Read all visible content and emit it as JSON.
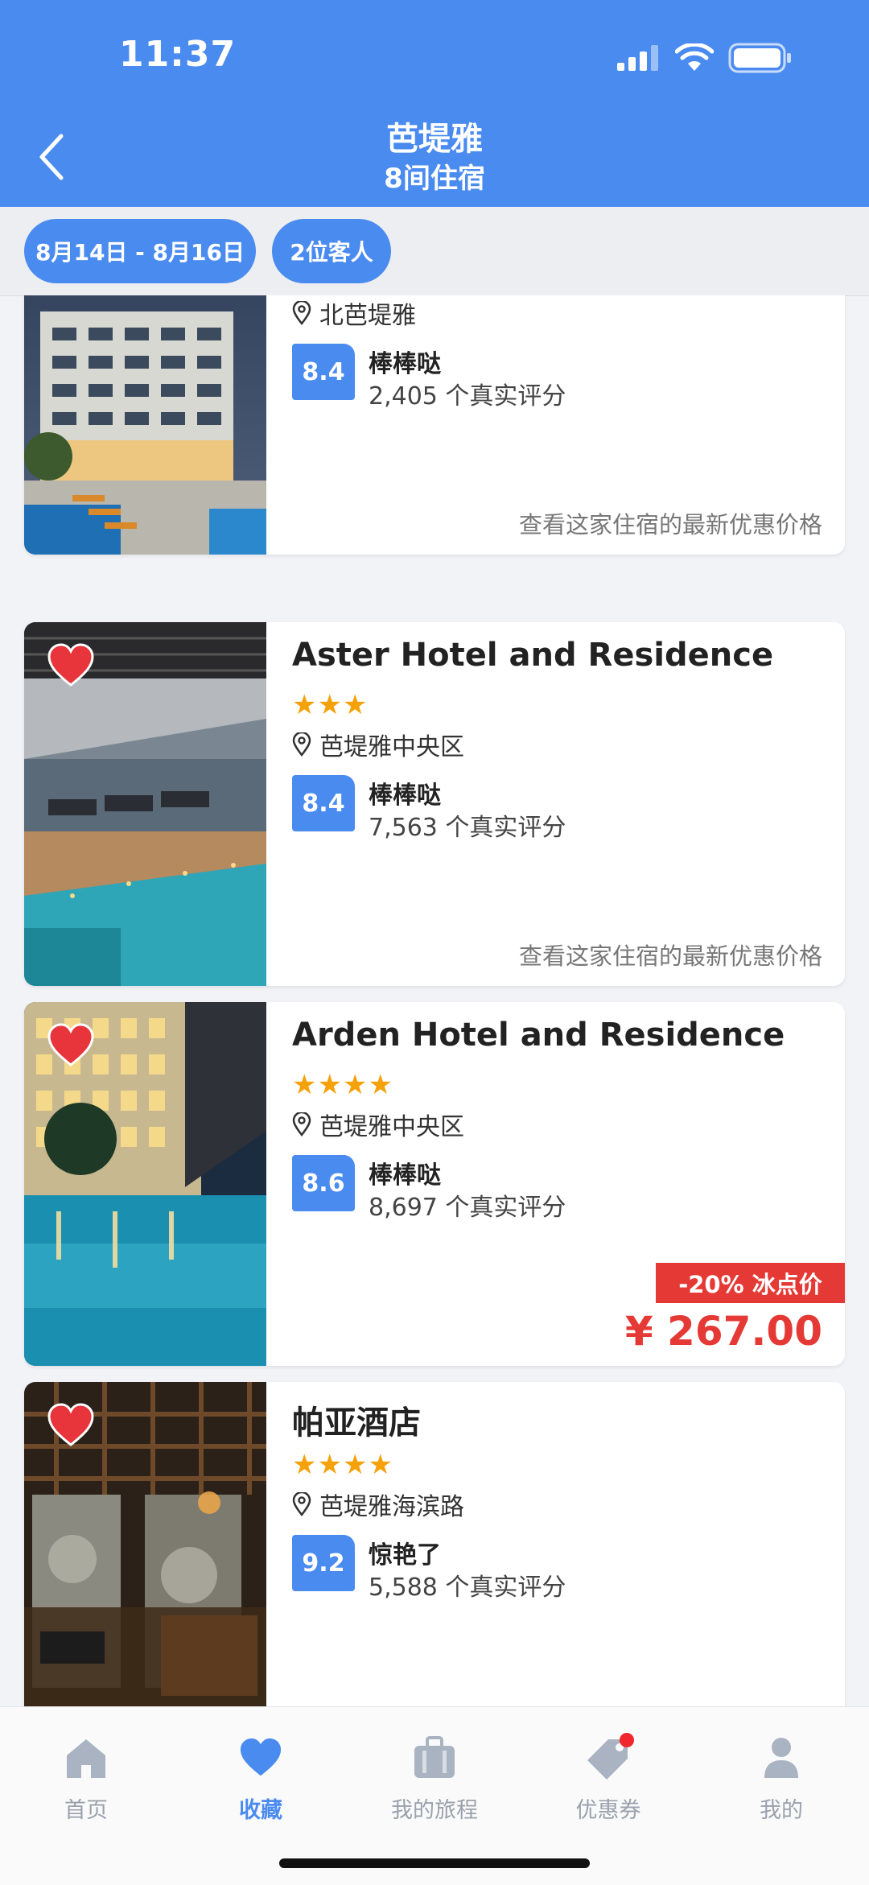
{
  "status_bar": {
    "time": "11:37"
  },
  "header": {
    "title": "芭堤雅",
    "subtitle": "8间住宿"
  },
  "filters": {
    "dates": "8月14日 - 8月16日",
    "guests": "2位客人"
  },
  "hotels": [
    {
      "name": "",
      "stars": "★★★★",
      "location": "北芭堤雅",
      "score": "8.4",
      "score_text": "棒棒哒",
      "reviews": "2,405 个真实评分",
      "price_hint": "查看这家住宿的最新优惠价格"
    },
    {
      "name": "Aster Hotel and Residence",
      "stars": "★★★",
      "location": "芭堤雅中央区",
      "score": "8.4",
      "score_text": "棒棒哒",
      "reviews": "7,563 个真实评分",
      "price_hint": "查看这家住宿的最新优惠价格"
    },
    {
      "name": "Arden Hotel and Residence",
      "stars": "★★★★",
      "location": "芭堤雅中央区",
      "score": "8.6",
      "score_text": "棒棒哒",
      "reviews": "8,697 个真实评分",
      "deal_tag": "-20% 冰点价",
      "price": "¥ 267.00"
    },
    {
      "name": "帕亚酒店",
      "stars": "★★★★",
      "location": "芭堤雅海滨路",
      "score": "9.2",
      "score_text": "惊艳了",
      "reviews": "5,588 个真实评分"
    }
  ],
  "tabbar": {
    "items": [
      {
        "label": "首页",
        "icon": "home-icon"
      },
      {
        "label": "收藏",
        "icon": "heart-icon",
        "active": true
      },
      {
        "label": "我的旅程",
        "icon": "suitcase-icon"
      },
      {
        "label": "优惠券",
        "icon": "tag-icon",
        "badge": true
      },
      {
        "label": "我的",
        "icon": "person-icon"
      }
    ]
  },
  "colors": {
    "primary": "#4a8bf0",
    "star": "#f5a10a",
    "deal": "#e53935",
    "heart": "#e8343b"
  }
}
